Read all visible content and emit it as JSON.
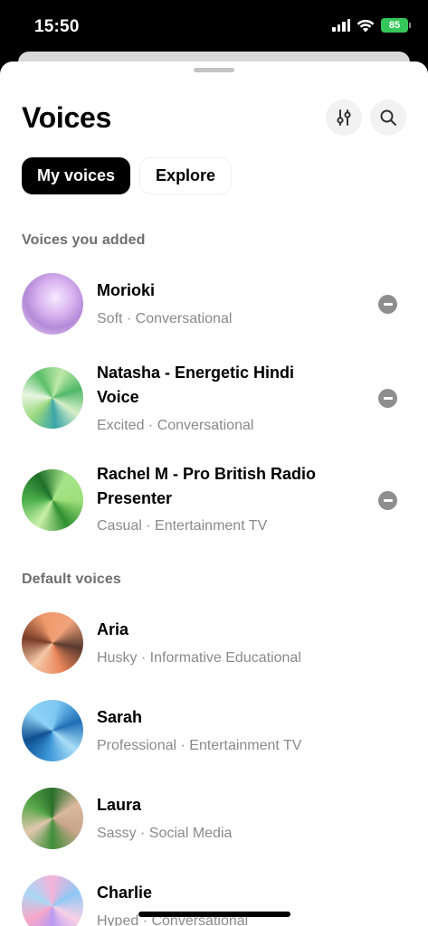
{
  "status_bar": {
    "time": "15:50",
    "battery": "85"
  },
  "header": {
    "title": "Voices",
    "filters_icon": "sliders-icon",
    "search_icon": "search-icon"
  },
  "tabs": [
    {
      "label": "My voices",
      "active": true
    },
    {
      "label": "Explore",
      "active": false
    }
  ],
  "sections": {
    "added_heading": "Voices you added",
    "default_heading": "Default voices"
  },
  "added_voices": [
    {
      "name": "Morioki",
      "tags": "Soft · Conversational",
      "color": "#c9a2e8"
    },
    {
      "name": "Natasha - Energetic Hindi Voice",
      "tags": "Excited · Conversational",
      "color": "#6fc27a"
    },
    {
      "name": "Rachel M - Pro British Radio Presenter",
      "tags": "Casual · Entertainment TV",
      "color": "#4bb04b"
    }
  ],
  "default_voices": [
    {
      "name": "Aria",
      "tags": "Husky · Informative Educational",
      "color": "#e8845a"
    },
    {
      "name": "Sarah",
      "tags": "Professional · Entertainment TV",
      "color": "#3b95d8"
    },
    {
      "name": "Laura",
      "tags": "Sassy · Social Media",
      "color": "#5aa84a"
    },
    {
      "name": "Charlie",
      "tags": "Hyped · Conversational",
      "color": "#f6b3d9"
    }
  ]
}
